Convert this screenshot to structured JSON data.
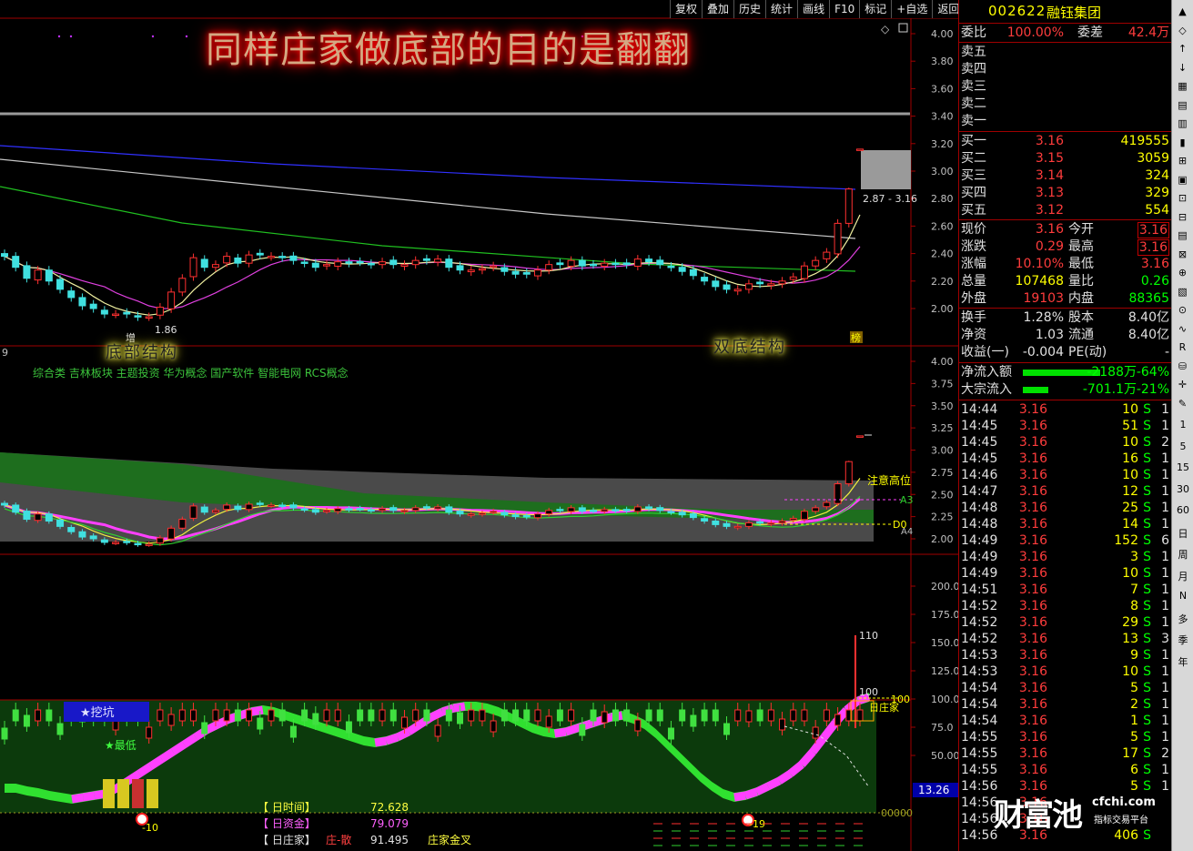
{
  "toolbar": [
    "复权",
    "叠加",
    "历史",
    "统计",
    "画线",
    "F10",
    "标记",
    "+自选",
    "返回"
  ],
  "headline": "同样庄家做底部的目的是翻翻",
  "annotations": {
    "bottom_structure": "底部结构",
    "double_bottom": "双底结构",
    "low_label": "1.86",
    "high_label": "2.87 - 3.16",
    "bang": "榜",
    "zeng": "增"
  },
  "concept_line": "综合类 吉林板块 主题投资 华为概念 国产软件 智能电网 RCS概念",
  "panel_left_number": "9",
  "panel2_labels": {
    "warning": "注意高位",
    "a3": "A3",
    "d0": "D0",
    "a4": "A4"
  },
  "panel3_labels": {
    "v110": "110",
    "v100": "100",
    "v100b": "100",
    "day_zhuangjia": "日庄家",
    "dig": "★挖坑",
    "lowest": "★最低",
    "neg10": "-10",
    "neg19": "-19",
    "zero": "00000",
    "cursor_value": "13.26"
  },
  "legend": [
    {
      "name": "【 日时间】",
      "value": "72.628",
      "color": "#ffff40"
    },
    {
      "name": "【 日资金】",
      "value": "79.079",
      "color": "#ff60ff"
    },
    {
      "name": "【 日庄家】",
      "value": "91.495",
      "color": "#e0e0e0"
    }
  ],
  "legend_extra": {
    "chip": "庄-散",
    "golden_cross": "庄家金叉"
  },
  "stock": {
    "code": "002622",
    "name": "融钰集团"
  },
  "quote_top": {
    "weibi_label": "委比",
    "weibi": "100.00%",
    "weicha_label": "委差",
    "weicha": "42.4万"
  },
  "asks": [
    "卖五",
    "卖四",
    "卖三",
    "卖二",
    "卖一"
  ],
  "bids": [
    {
      "label": "买一",
      "price": "3.16",
      "vol": "419555"
    },
    {
      "label": "买二",
      "price": "3.15",
      "vol": "3059"
    },
    {
      "label": "买三",
      "price": "3.14",
      "vol": "324"
    },
    {
      "label": "买四",
      "price": "3.13",
      "vol": "329"
    },
    {
      "label": "买五",
      "price": "3.12",
      "vol": "554"
    }
  ],
  "stats": [
    {
      "l1": "现价",
      "v1": "3.16",
      "c1": "red",
      "l2": "今开",
      "v2": "3.16",
      "c2": "red",
      "box": true
    },
    {
      "l1": "涨跌",
      "v1": "0.29",
      "c1": "red",
      "l2": "最高",
      "v2": "3.16",
      "c2": "red",
      "box": true
    },
    {
      "l1": "涨幅",
      "v1": "10.10%",
      "c1": "red",
      "l2": "最低",
      "v2": "3.16",
      "c2": "red",
      "box": false
    },
    {
      "l1": "总量",
      "v1": "107468",
      "c1": "ylw",
      "l2": "量比",
      "v2": "0.26",
      "c2": "grn",
      "box": false
    },
    {
      "l1": "外盘",
      "v1": "19103",
      "c1": "red",
      "l2": "内盘",
      "v2": "88365",
      "c2": "grn",
      "box": false
    }
  ],
  "stats2": [
    {
      "l1": "换手",
      "v1": "1.28%",
      "l2": "股本",
      "v2": "8.40亿"
    },
    {
      "l1": "净资",
      "v1": "1.03",
      "l2": "流通",
      "v2": "8.40亿"
    },
    {
      "l1": "收益(一)",
      "v1": "-0.004",
      "l2": "PE(动)",
      "v2": "-"
    }
  ],
  "flows": [
    {
      "label": "净流入额",
      "value": "-2188万",
      "pct": "-64%",
      "bar": 0.64
    },
    {
      "label": "大宗流入",
      "value": "-701.1万",
      "pct": "-21%",
      "bar": 0.21
    }
  ],
  "ticks": [
    [
      "14:44",
      "3.16",
      "10",
      "S",
      "1"
    ],
    [
      "14:45",
      "3.16",
      "51",
      "S",
      "1"
    ],
    [
      "14:45",
      "3.16",
      "10",
      "S",
      "2"
    ],
    [
      "14:45",
      "3.16",
      "16",
      "S",
      "1"
    ],
    [
      "14:46",
      "3.16",
      "10",
      "S",
      "1"
    ],
    [
      "14:47",
      "3.16",
      "12",
      "S",
      "1"
    ],
    [
      "14:48",
      "3.16",
      "25",
      "S",
      "1"
    ],
    [
      "14:48",
      "3.16",
      "14",
      "S",
      "1"
    ],
    [
      "14:49",
      "3.16",
      "152",
      "S",
      "6"
    ],
    [
      "14:49",
      "3.16",
      "3",
      "S",
      "1"
    ],
    [
      "14:49",
      "3.16",
      "10",
      "S",
      "1"
    ],
    [
      "14:51",
      "3.16",
      "7",
      "S",
      "1"
    ],
    [
      "14:52",
      "3.16",
      "8",
      "S",
      "1"
    ],
    [
      "14:52",
      "3.16",
      "29",
      "S",
      "1"
    ],
    [
      "14:52",
      "3.16",
      "13",
      "S",
      "3"
    ],
    [
      "14:53",
      "3.16",
      "9",
      "S",
      "1"
    ],
    [
      "14:53",
      "3.16",
      "10",
      "S",
      "1"
    ],
    [
      "14:54",
      "3.16",
      "5",
      "S",
      "1"
    ],
    [
      "14:54",
      "3.16",
      "2",
      "S",
      "1"
    ],
    [
      "14:54",
      "3.16",
      "1",
      "S",
      "1"
    ],
    [
      "14:55",
      "3.16",
      "5",
      "S",
      "1"
    ],
    [
      "14:55",
      "3.16",
      "17",
      "S",
      "2"
    ],
    [
      "14:55",
      "3.16",
      "6",
      "S",
      "1"
    ],
    [
      "14:56",
      "3.16",
      "5",
      "S",
      "1"
    ],
    [
      "14:56",
      "3.16",
      "",
      "",
      ""
    ],
    [
      "14:56",
      "3.16",
      "",
      "",
      ""
    ],
    [
      "14:56",
      "3.16",
      "406",
      "S",
      ""
    ]
  ],
  "logo": {
    "big": "财富池",
    "url": "cfchi.com",
    "sub": "指标交易平台"
  },
  "sidebar_periods": [
    "1",
    "5",
    "15",
    "30",
    "60",
    "日",
    "周",
    "月",
    "N",
    "多",
    "季",
    "年"
  ],
  "chart_data": [
    {
      "type": "candlestick",
      "title": "同样庄家做底部的目的是翻翻",
      "y_ticks": [
        "4.00",
        "3.80",
        "3.60",
        "3.40",
        "3.20",
        "3.00",
        "2.80",
        "2.60",
        "2.40",
        "2.20",
        "2.00"
      ],
      "ylim": [
        1.88,
        4.0
      ],
      "close": [
        2.38,
        2.3,
        2.22,
        2.28,
        2.2,
        2.14,
        2.08,
        2.02,
        2.0,
        1.96,
        1.96,
        1.96,
        1.94,
        1.94,
        2.01,
        2.12,
        2.22,
        2.37,
        2.3,
        2.32,
        2.38,
        2.33,
        2.39,
        2.39,
        2.38,
        2.37,
        2.35,
        2.33,
        2.3,
        2.32,
        2.34,
        2.33,
        2.34,
        2.32,
        2.34,
        2.32,
        2.32,
        2.35,
        2.35,
        2.36,
        2.3,
        2.28,
        2.28,
        2.29,
        2.31,
        2.27,
        2.25,
        2.25,
        2.28,
        2.32,
        2.32,
        2.35,
        2.31,
        2.32,
        2.33,
        2.32,
        2.32,
        2.36,
        2.34,
        2.32,
        2.3,
        2.27,
        2.24,
        2.2,
        2.16,
        2.14,
        2.14,
        2.18,
        2.18,
        2.18,
        2.2,
        2.23,
        2.31,
        2.35,
        2.41,
        2.62,
        2.87,
        3.16
      ]
    },
    {
      "type": "candlestick_band",
      "y_ticks": [
        "4.00",
        "3.75",
        "3.50",
        "3.25",
        "3.00",
        "2.75",
        "2.50",
        "2.25",
        "2.00"
      ],
      "ylim": [
        1.95,
        4.0
      ],
      "labels": [
        "注意高位",
        "A3",
        "D0",
        "A4"
      ]
    },
    {
      "type": "oscillator",
      "y_ticks": [
        "200.0",
        "175.0",
        "150.0",
        "125.0",
        "100.0",
        "75.0",
        "50.00"
      ],
      "ylim": [
        0,
        200
      ],
      "series": [
        {
          "name": "日时间",
          "last": 72.628
        },
        {
          "name": "日资金",
          "last": 79.079
        },
        {
          "name": "日庄家",
          "last": 91.495
        }
      ],
      "wave": [
        0,
        0,
        -3,
        -5,
        -8,
        -10,
        -12,
        -10,
        -8,
        -6,
        0,
        8,
        16,
        24,
        32,
        40,
        48,
        56,
        64,
        70,
        76,
        80,
        84,
        86,
        84,
        80,
        76,
        72,
        68,
        64,
        60,
        56,
        52,
        50,
        52,
        56,
        62,
        70,
        78,
        84,
        88,
        90,
        90,
        88,
        84,
        78,
        72,
        66,
        62,
        60,
        62,
        66,
        70,
        74,
        78,
        80,
        76,
        70,
        60,
        48,
        36,
        24,
        12,
        2,
        -6,
        -10,
        -8,
        -4,
        2,
        8,
        16,
        26,
        40,
        56,
        72,
        86,
        96,
        100
      ]
    }
  ]
}
